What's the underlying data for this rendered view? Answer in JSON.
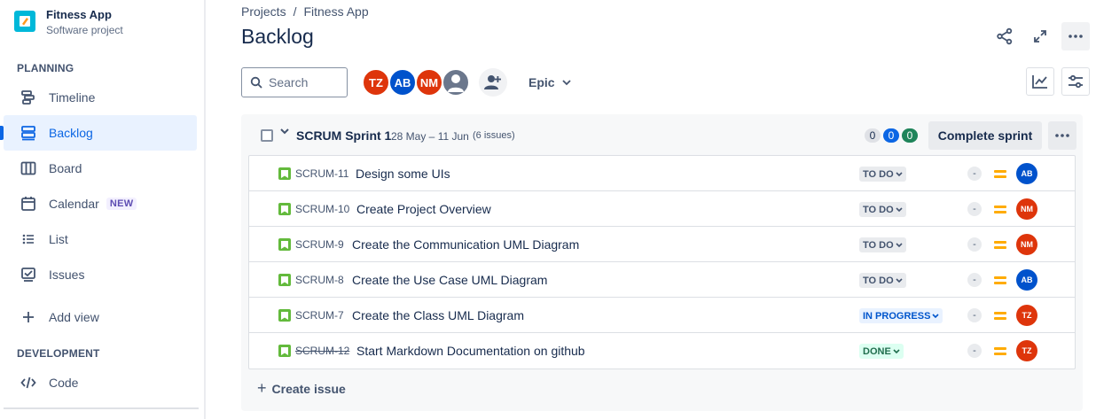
{
  "project": {
    "name": "Fitness App",
    "type": "Software project"
  },
  "sidebar": {
    "planning_heading": "PLANNING",
    "development_heading": "DEVELOPMENT",
    "items": [
      {
        "label": "Timeline",
        "icon": "timeline-icon"
      },
      {
        "label": "Backlog",
        "icon": "backlog-icon",
        "active": true
      },
      {
        "label": "Board",
        "icon": "board-icon"
      },
      {
        "label": "Calendar",
        "icon": "calendar-icon",
        "badge": "NEW"
      },
      {
        "label": "List",
        "icon": "list-icon"
      },
      {
        "label": "Issues",
        "icon": "issues-icon"
      },
      {
        "label": "Add view",
        "icon": "plus-icon"
      }
    ],
    "dev_items": [
      {
        "label": "Code",
        "icon": "code-icon"
      }
    ]
  },
  "breadcrumbs": [
    "Projects",
    "Fitness App"
  ],
  "page_title": "Backlog",
  "search": {
    "placeholder": "Search"
  },
  "avatars": [
    {
      "initials": "TZ",
      "color": "#de350b"
    },
    {
      "initials": "AB",
      "color": "#0052cc"
    },
    {
      "initials": "NM",
      "color": "#de350b"
    },
    {
      "initials": "",
      "color": "#6b778c"
    }
  ],
  "epic_filter": "Epic",
  "sprint": {
    "name": "SCRUM Sprint 1",
    "dates": "28 May – 11 Jun",
    "count": "(6 issues)",
    "points": [
      {
        "value": "0",
        "bg": "#dfe1e6",
        "fg": "#172b4d"
      },
      {
        "value": "0",
        "bg": "#0c66e4",
        "fg": "#ffffff"
      },
      {
        "value": "0",
        "bg": "#1f845a",
        "fg": "#ffffff"
      }
    ],
    "complete_label": "Complete sprint",
    "create_label": "Create issue"
  },
  "issues": [
    {
      "key": "SCRUM-11",
      "summary": "Design some UIs",
      "status": "TO DO",
      "est": "-",
      "assignee": "AB",
      "assignee_color": "#0052cc"
    },
    {
      "key": "SCRUM-10",
      "summary": "Create Project Overview",
      "status": "TO DO",
      "est": "-",
      "assignee": "NM",
      "assignee_color": "#de350b"
    },
    {
      "key": "SCRUM-9",
      "summary": "Create the Communication UML Diagram",
      "status": "TO DO",
      "est": "-",
      "assignee": "NM",
      "assignee_color": "#de350b"
    },
    {
      "key": "SCRUM-8",
      "summary": "Create the Use Case UML Diagram",
      "status": "TO DO",
      "est": "-",
      "assignee": "AB",
      "assignee_color": "#0052cc"
    },
    {
      "key": "SCRUM-7",
      "summary": "Create the Class UML Diagram",
      "status": "IN PROGRESS",
      "est": "-",
      "assignee": "TZ",
      "assignee_color": "#de350b"
    },
    {
      "key": "SCRUM-12",
      "summary": "Start Markdown Documentation on github",
      "status": "DONE",
      "est": "-",
      "assignee": "TZ",
      "assignee_color": "#de350b",
      "done": true
    }
  ]
}
